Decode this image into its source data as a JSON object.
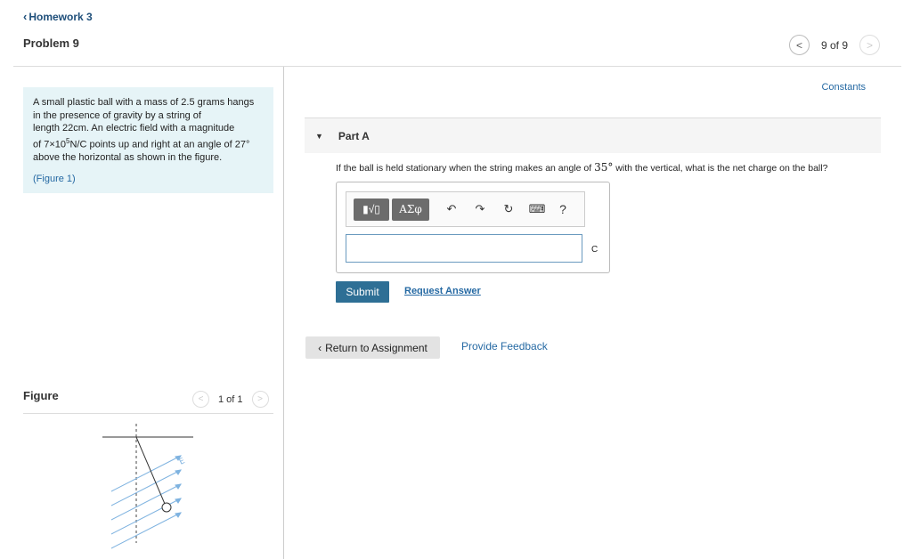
{
  "header": {
    "back_label": "Homework 3",
    "problem_title": "Problem 9",
    "pager": {
      "count": "9 of 9",
      "prev": "<",
      "next": ">"
    }
  },
  "problem": {
    "line1": "A small plastic ball with a mass of 2.5 grams hangs",
    "line2": "in the presence of gravity by a string of",
    "line3": "length 22cm.  An electric field with a magnitude",
    "line4_pre": "of 7×10",
    "line4_sup": "5",
    "line4_post": "N/C points up and right at an angle of 27°",
    "line5": "above the horizontal as shown in the figure.",
    "figure_link_open": "(",
    "figure_link_text": "Figure 1",
    "figure_link_close": ")"
  },
  "figure": {
    "title": "Figure",
    "pager_count": "1 of 1",
    "field_label": "E"
  },
  "part": {
    "constants_label": "Constants",
    "label": "Part A",
    "question_pre": "If the ball is held stationary when the string makes an angle of ",
    "question_angle": "35°",
    "question_post": " with the vertical, what is the net charge on the ball?",
    "toolbar": {
      "frac_label": "▮√▯",
      "greek_label": "ΑΣφ",
      "undo_icon": "↶",
      "redo_icon": "↷",
      "reset_icon": "↻",
      "keyboard_icon": "⌨",
      "help_label": "?"
    },
    "answer_value": "",
    "unit": "C",
    "submit_label": "Submit",
    "request_answer_label": "Request Answer"
  },
  "footer": {
    "return_label": "Return to Assignment",
    "feedback_label": "Provide Feedback"
  },
  "colors": {
    "link": "#2569a3",
    "submit_bg": "#2e6f95",
    "problem_bg": "#e6f4f7",
    "field_lines": "#7fb3e0"
  }
}
